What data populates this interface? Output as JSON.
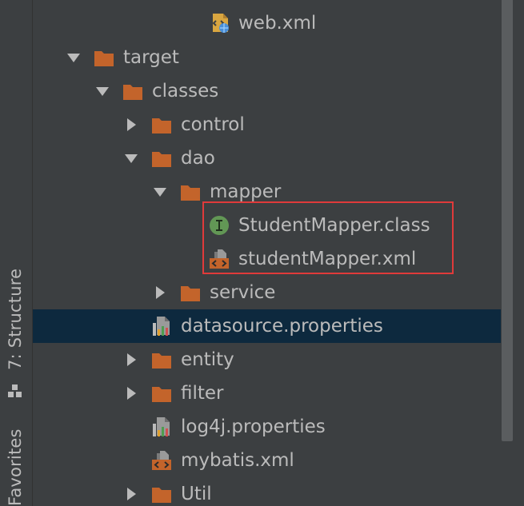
{
  "side_tabs": {
    "structure_label": "7: Structure",
    "favorites_label": "Favorites"
  },
  "tree": {
    "rows": [
      {
        "label": "web.xml",
        "kind": "xml-web",
        "expanded": null
      },
      {
        "label": "target",
        "kind": "folder",
        "expanded": true
      },
      {
        "label": "classes",
        "kind": "folder",
        "expanded": true
      },
      {
        "label": "control",
        "kind": "folder",
        "expanded": false
      },
      {
        "label": "dao",
        "kind": "folder",
        "expanded": true
      },
      {
        "label": "mapper",
        "kind": "folder",
        "expanded": true
      },
      {
        "label": "StudentMapper.class",
        "kind": "interface-class",
        "expanded": null
      },
      {
        "label": "studentMapper.xml",
        "kind": "xml",
        "expanded": null
      },
      {
        "label": "service",
        "kind": "folder",
        "expanded": false
      },
      {
        "label": "datasource.properties",
        "kind": "properties",
        "expanded": null,
        "selected": true
      },
      {
        "label": "entity",
        "kind": "folder",
        "expanded": false
      },
      {
        "label": "filter",
        "kind": "folder",
        "expanded": false
      },
      {
        "label": "log4j.properties",
        "kind": "properties",
        "expanded": null
      },
      {
        "label": "mybatis.xml",
        "kind": "xml",
        "expanded": null
      },
      {
        "label": "Util",
        "kind": "folder",
        "expanded": false
      }
    ]
  },
  "colors": {
    "panel_bg": "#3c3f41",
    "selection_bg": "#0d293e",
    "text": "#bbbbbb",
    "folder": "#c3642b",
    "highlight_border": "#e03a3a"
  }
}
